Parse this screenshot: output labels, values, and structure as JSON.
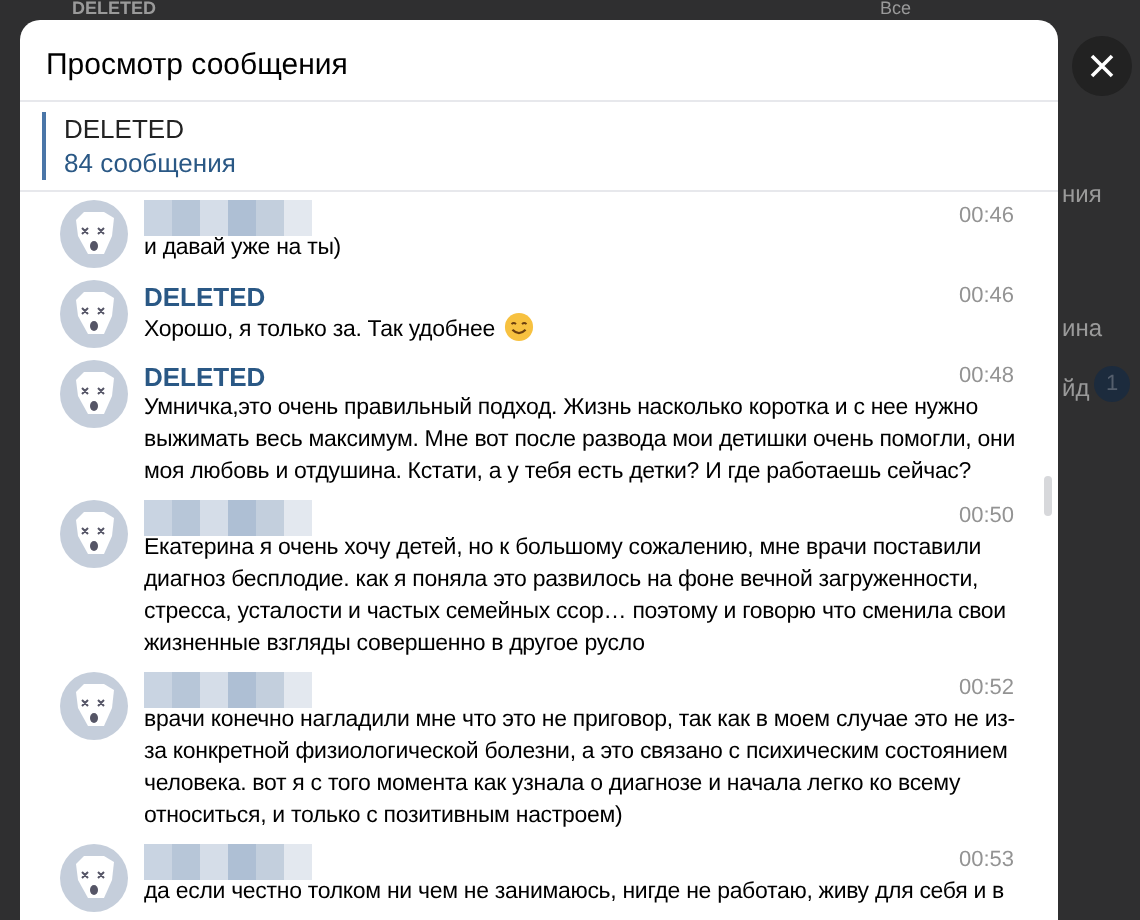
{
  "background": {
    "top_name": "DELETED",
    "filter": "Все",
    "fragment_1": "ния",
    "fragment_2": "ина",
    "fragment_3": "йд",
    "badge": "1"
  },
  "modal": {
    "title": "Просмотр сообщения",
    "chat": {
      "name": "DELETED",
      "count": "84 сообщения"
    }
  },
  "messages": [
    {
      "author": {
        "kind": "blurred"
      },
      "time": "00:46",
      "text": "и давай уже на ты)"
    },
    {
      "author": {
        "kind": "name",
        "text": "DELETED"
      },
      "time": "00:46",
      "text": "Хорошо, я только за. Так удобнее",
      "emoji": true
    },
    {
      "author": {
        "kind": "name",
        "text": "DELETED"
      },
      "time": "00:48",
      "text": "Умничка,это очень правильный подход. Жизнь насколько коротка и с нее нужно выжимать весь максимум. Мне вот после развода мои детишки очень помогли, они моя любовь и отдушина. Кстати, а у тебя есть детки? И где работаешь сейчас?"
    },
    {
      "author": {
        "kind": "blurred"
      },
      "time": "00:50",
      "text": "Екатерина я очень хочу детей, но к большому сожалению, мне врачи поставили диагноз бесплодие. как я поняла это развилось на фоне вечной загруженности, стресса, усталости и частых семейных ссор… поэтому и говорю что сменила свои жизненные взгляды совершенно в другое русло"
    },
    {
      "author": {
        "kind": "blurred"
      },
      "time": "00:52",
      "text": "врачи конечно нагладили мне что это не приговор, так как в моем случае это не из-за конкретной физиологической болезни, а это связано с психическим состоянием человека. вот я с того момента как узнала о диагнозе и начала легко ко всему относиться, и только с позитивным настроем)"
    },
    {
      "author": {
        "kind": "blurred"
      },
      "time": "00:53",
      "text": "да если честно толком ни чем не занимаюсь, нигде не работаю, живу для себя и в"
    }
  ]
}
